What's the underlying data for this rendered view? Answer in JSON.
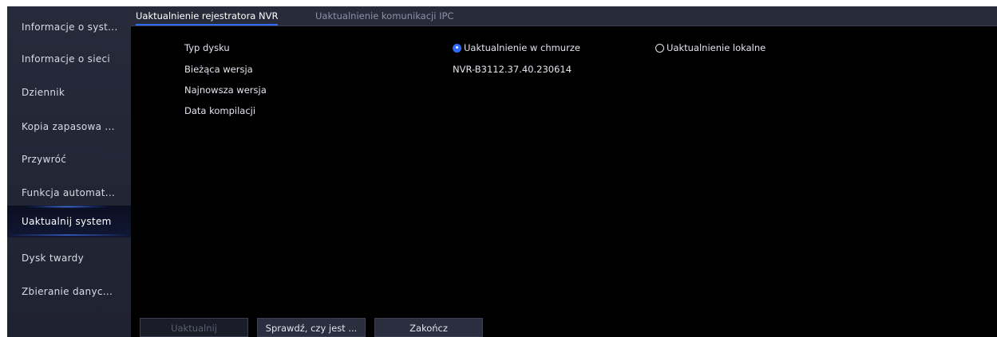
{
  "sidebar": {
    "items": [
      {
        "label": "Informacje o syst..."
      },
      {
        "label": "Informacje o sieci"
      },
      {
        "label": "Dziennik"
      },
      {
        "label": "Kopia zapasowa ..."
      },
      {
        "label": "Przywróć"
      },
      {
        "label": "Funkcja automat..."
      },
      {
        "label": "Uaktualnij system",
        "active": true
      },
      {
        "label": "Dysk twardy"
      },
      {
        "label": "Zbieranie danyc..."
      }
    ]
  },
  "tabs": [
    {
      "label": "Uaktualnienie rejestratora NVR",
      "active": true
    },
    {
      "label": "Uaktualnienie komunikacji IPC",
      "active": false
    }
  ],
  "form": {
    "disk_type_label": "Typ dysku",
    "current_version_label": "Bieżąca wersja",
    "current_version_value": "NVR-B3112.37.40.230614",
    "latest_version_label": "Najnowsza wersja",
    "build_date_label": "Data kompilacji",
    "radio_cloud": "Uaktualnienie w chmurze",
    "radio_local": "Uaktualnienie lokalne",
    "selected_option": "cloud"
  },
  "buttons": {
    "upgrade": "Uaktualnij",
    "check": "Sprawdź, czy jest ...",
    "exit": "Zakończ"
  },
  "colors": {
    "accent": "#2f6bff",
    "background": "#000000",
    "sidebar": "#262a3a"
  }
}
